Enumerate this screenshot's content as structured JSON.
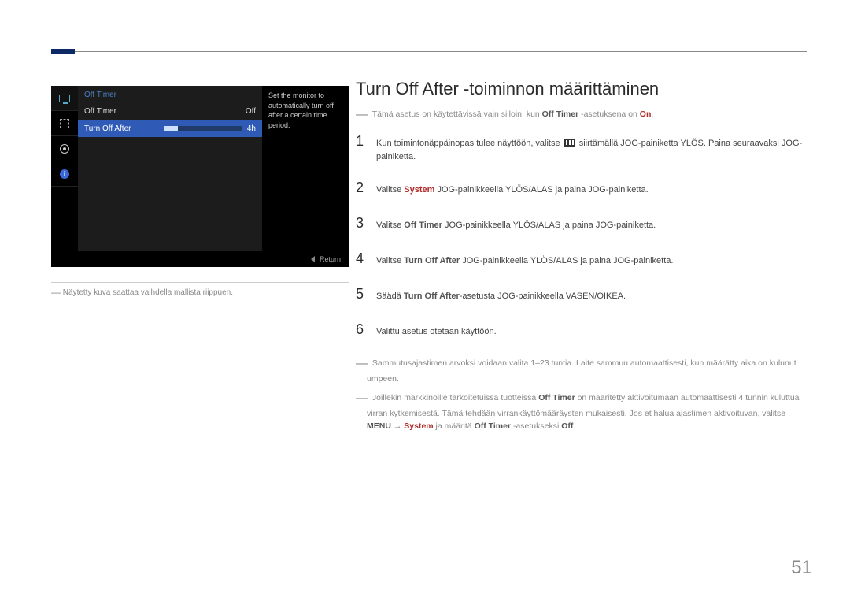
{
  "osd": {
    "title": "Off Timer",
    "rows": [
      {
        "label": "Off Timer",
        "value": "Off"
      },
      {
        "label": "Turn Off After",
        "value": "4h"
      }
    ],
    "description": "Set the monitor to automatically turn off after a certain time period.",
    "footer": "Return"
  },
  "caption": "Näytetty kuva saattaa vaihdella mallista riippuen.",
  "heading": "Turn Off After -toiminnon määrittäminen",
  "intro_note": {
    "pre": "Tämä asetus on käytettävissä vain silloin, kun ",
    "bold": "Off Timer",
    "mid": " -asetuksena on ",
    "on": "On",
    "post": "."
  },
  "steps": {
    "s1a": "Kun toimintonäppäinopas tulee näyttöön, valitse ",
    "s1b": " siirtämällä JOG-painiketta YLÖS. Paina seuraavaksi JOG-painiketta.",
    "s2a": "Valitse ",
    "s2sys": "System",
    "s2b": " JOG-painikkeella YLÖS/ALAS ja paina JOG-painiketta.",
    "s3a": "Valitse ",
    "s3bold": "Off Timer",
    "s3b": " JOG-painikkeella YLÖS/ALAS ja paina JOG-painiketta.",
    "s4a": "Valitse ",
    "s4bold": "Turn Off After",
    "s4b": " JOG-painikkeella YLÖS/ALAS ja paina JOG-painiketta.",
    "s5a": "Säädä ",
    "s5bold": "Turn Off After",
    "s5b": "-asetusta JOG-painikkeella VASEN/OIKEA.",
    "s6": "Valittu asetus otetaan käyttöön."
  },
  "note2": "Sammutusajastimen arvoksi voidaan valita 1–23 tuntia. Laite sammuu automaattisesti, kun määrätty aika on kulunut umpeen.",
  "note3": {
    "a": "Joillekin markkinoille tarkoitetuissa tuotteissa ",
    "b": "Off Timer",
    "c": " on määritetty aktivoitumaan automaattisesti 4 tunnin kuluttua virran kytkemisestä. Tämä tehdään virrankäyttömääräysten mukaisesti. Jos et halua ajastimen aktivoituvan, valitse ",
    "menu": "MENU",
    "arrow": " → ",
    "sys": "System",
    "d": " ja määritä ",
    "e": "Off Timer",
    "f": " -asetukseksi ",
    "off": "Off",
    "g": "."
  },
  "page": "51",
  "nums": {
    "n1": "1",
    "n2": "2",
    "n3": "3",
    "n4": "4",
    "n5": "5",
    "n6": "6"
  },
  "info_i": "i"
}
